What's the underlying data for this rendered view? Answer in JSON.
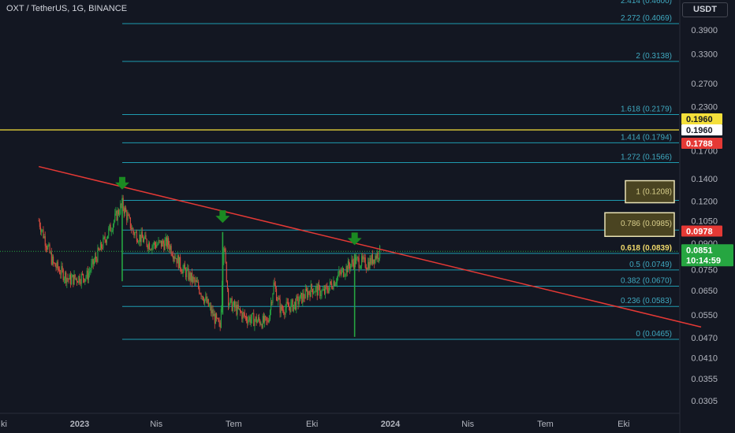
{
  "header": {
    "title": "OXT / TetherUS, 1G, BINANCE",
    "currency": "USDT"
  },
  "colors": {
    "background": "#131722",
    "fib": "#1e9bb0",
    "fib_text": "#3fa9c0",
    "trend": "#e53935",
    "hline": "#f5e03b",
    "candle_up": "#26a641",
    "candle_down": "#d84c3e",
    "arrow": "#1b8a22",
    "axis_text": "#b2b5be"
  },
  "chart_data": {
    "type": "candlestick",
    "pair": "OXT / TetherUS",
    "timeframe": "1G",
    "exchange": "BINANCE",
    "y_scale": "log",
    "yaxis_ticks": [
      "0.3900",
      "0.3300",
      "0.2700",
      "0.2300",
      "0.1700",
      "0.1400",
      "0.1200",
      "0.1050",
      "0.0900",
      "0.0750",
      "0.0650",
      "0.0550",
      "0.0470",
      "0.0410",
      "0.0355",
      "0.0305"
    ],
    "xaxis_ticks": [
      "ki",
      "2023",
      "Nis",
      "Tem",
      "Eki",
      "2024",
      "Nis",
      "Tem",
      "Eki"
    ],
    "fib_levels": [
      {
        "ratio": "2.272",
        "price": 0.4069,
        "label": "2.272 (0.4069)"
      },
      {
        "ratio": "2",
        "price": 0.3138,
        "label": "2 (0.3138)"
      },
      {
        "ratio": "1.618",
        "price": 0.2179,
        "label": "1.618 (0.2179)"
      },
      {
        "ratio": "1.414",
        "price": 0.1794,
        "label": "1.414 (0.1794)"
      },
      {
        "ratio": "1.272",
        "price": 0.1566,
        "label": "1.272 (0.1566)"
      },
      {
        "ratio": "1",
        "price": 0.1208,
        "label": "1 (0.1208)"
      },
      {
        "ratio": "0.786",
        "price": 0.0985,
        "label": "0.786 (0.0985)"
      },
      {
        "ratio": "0.618",
        "price": 0.0839,
        "label": "0.618 (0.0839)"
      },
      {
        "ratio": "0.5",
        "price": 0.0749,
        "label": "0.5 (0.0749)"
      },
      {
        "ratio": "0.382",
        "price": 0.067,
        "label": "0.382 (0.0670)"
      },
      {
        "ratio": "0.236",
        "price": 0.0583,
        "label": "0.236 (0.0583)"
      },
      {
        "ratio": "0",
        "price": 0.0465,
        "label": "0 (0.0465)"
      }
    ],
    "horizontal_line": {
      "price": 0.196
    },
    "price_labels": [
      {
        "text": "0.1960",
        "price": 0.196,
        "bg": "#f5e03b",
        "fg": "#131722"
      },
      {
        "text": "0.1960",
        "price": 0.196,
        "bg": "#ffffff",
        "fg": "#131722"
      },
      {
        "text": "0.1788",
        "price": 0.1788,
        "bg": "#e53935",
        "fg": "#ffffff"
      },
      {
        "text": "0.0978",
        "price": 0.0978,
        "bg": "#e53935",
        "fg": "#ffffff"
      },
      {
        "text": "0.0851",
        "price": 0.0851,
        "bg": "#26a641",
        "fg": "#ffffff",
        "sub": "10:14:59"
      }
    ],
    "trendline": {
      "start": {
        "date": "2022-11-14",
        "price": 0.1524
      },
      "end": {
        "date": "2024-12-31",
        "price": 0.0506
      }
    },
    "current_price": 0.0851,
    "countdown": "10:14:59",
    "touch_points": [
      {
        "date": "2023-02-20",
        "price": 0.126
      },
      {
        "date": "2023-06-18",
        "price": 0.1002
      },
      {
        "date": "2023-11-20",
        "price": 0.086
      }
    ],
    "price_path": [
      {
        "date": "2022-11-14",
        "price": 0.105
      },
      {
        "date": "2022-12-01",
        "price": 0.078
      },
      {
        "date": "2022-12-20",
        "price": 0.07
      },
      {
        "date": "2023-01-10",
        "price": 0.072
      },
      {
        "date": "2023-02-01",
        "price": 0.094
      },
      {
        "date": "2023-02-20",
        "price": 0.118
      },
      {
        "date": "2023-03-05",
        "price": 0.097
      },
      {
        "date": "2023-03-25",
        "price": 0.089
      },
      {
        "date": "2023-04-15",
        "price": 0.09
      },
      {
        "date": "2023-05-01",
        "price": 0.076
      },
      {
        "date": "2023-05-20",
        "price": 0.067
      },
      {
        "date": "2023-06-05",
        "price": 0.056
      },
      {
        "date": "2023-06-15",
        "price": 0.05
      },
      {
        "date": "2023-06-19",
        "price": 0.092
      },
      {
        "date": "2023-06-25",
        "price": 0.06
      },
      {
        "date": "2023-07-15",
        "price": 0.054
      },
      {
        "date": "2023-08-10",
        "price": 0.052
      },
      {
        "date": "2023-08-17",
        "price": 0.068
      },
      {
        "date": "2023-08-25",
        "price": 0.057
      },
      {
        "date": "2023-09-10",
        "price": 0.059
      },
      {
        "date": "2023-10-01",
        "price": 0.066
      },
      {
        "date": "2023-10-15",
        "price": 0.064
      },
      {
        "date": "2023-11-01",
        "price": 0.072
      },
      {
        "date": "2023-11-20",
        "price": 0.08
      },
      {
        "date": "2023-12-05",
        "price": 0.078
      },
      {
        "date": "2023-12-20",
        "price": 0.0851
      }
    ]
  }
}
